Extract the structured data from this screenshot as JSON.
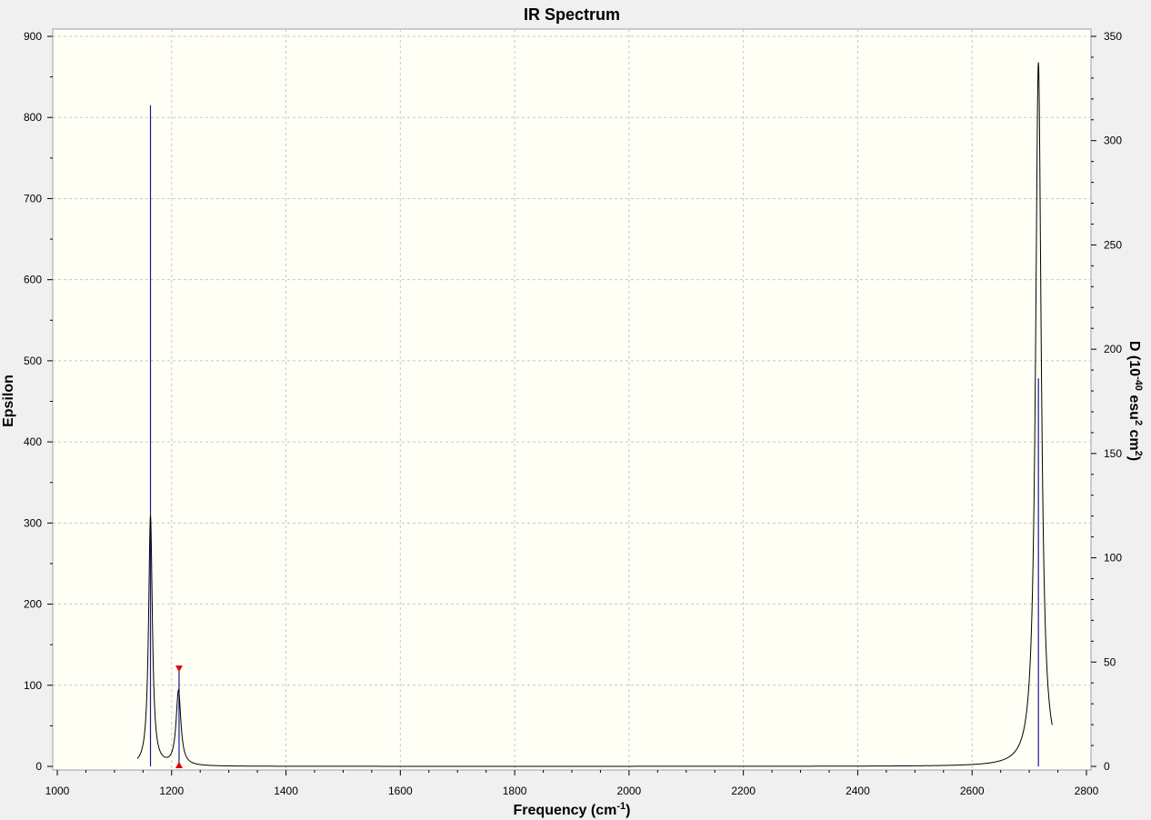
{
  "chart_data": {
    "type": "line",
    "title": "IR Spectrum",
    "xlabel": {
      "base": "Frequency (cm",
      "sup": "-1",
      "tail": ")"
    },
    "ylabel": "Epsilon",
    "y2label": {
      "p1": "D (10",
      "sup1": "-40",
      "p2": " esu",
      "sup2": "2",
      "p3": " cm",
      "sup3": "2",
      "p4": ")"
    },
    "xlim": [
      1000,
      2800
    ],
    "ylim": [
      0,
      900
    ],
    "y2lim": [
      0,
      350
    ],
    "x_ticks": [
      "1000",
      "1200",
      "1400",
      "1600",
      "1800",
      "2000",
      "2200",
      "2400",
      "2600",
      "2800"
    ],
    "y_ticks": [
      "0",
      "100",
      "200",
      "300",
      "400",
      "500",
      "600",
      "700",
      "800",
      "900"
    ],
    "y2_ticks": [
      "0",
      "50",
      "100",
      "150",
      "200",
      "250",
      "300",
      "350"
    ],
    "grid": true,
    "colors": {
      "plot_background": "#fffff6",
      "spectrum_line": "#000000",
      "stick_line": "#1a1a8c",
      "marker": "#dd0000",
      "grid": "#c8c8c8"
    },
    "spectrum_peaks": [
      {
        "x": 1163,
        "y": 308,
        "hwhm": 4
      },
      {
        "x": 1212,
        "y": 92,
        "hwhm": 5
      },
      {
        "x": 2716,
        "y": 868,
        "hwhm": 6
      }
    ],
    "spectrum_range": [
      1140,
      2740
    ],
    "sticks": [
      {
        "x": 1163,
        "y2": 317
      },
      {
        "x": 1213,
        "y2": 47
      },
      {
        "x": 2716,
        "y2": 186
      }
    ],
    "selected_stick_x": 1213
  }
}
